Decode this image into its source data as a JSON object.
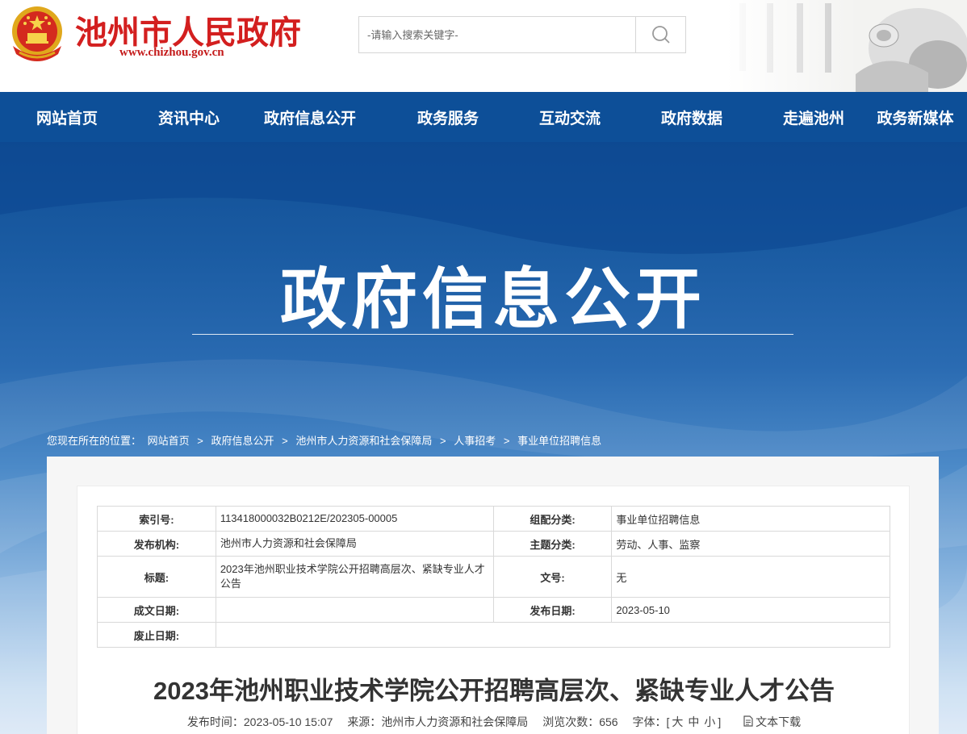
{
  "header": {
    "site_name": "池州市人民政府",
    "site_url": "www.chizhou.gov.cn",
    "search_placeholder": "-请输入搜索关键字-",
    "emblem_icon": "national-emblem-icon",
    "search_icon": "search-icon"
  },
  "nav": {
    "items": [
      {
        "label": "网站首页"
      },
      {
        "label": "资讯中心"
      },
      {
        "label": "政府信息公开"
      },
      {
        "label": "政务服务"
      },
      {
        "label": "互动交流"
      },
      {
        "label": "政府数据"
      },
      {
        "label": "走遍池州"
      },
      {
        "label": "政务新媒体"
      }
    ]
  },
  "banner": {
    "title": "政府信息公开"
  },
  "breadcrumb": {
    "prefix": "您现在所在的位置：",
    "items": [
      "网站首页",
      "政府信息公开",
      "池州市人力资源和社会保障局",
      "人事招考",
      "事业单位招聘信息"
    ],
    "separator": ">"
  },
  "meta": {
    "index_label": "索引号:",
    "index_value": "113418000032B0212E/202305-00005",
    "category_label": "组配分类:",
    "category_value": "事业单位招聘信息",
    "publisher_label": "发布机构:",
    "publisher_value": "池州市人力资源和社会保障局",
    "topic_label": "主题分类:",
    "topic_value": "劳动、人事、监察",
    "title_label": "标题:",
    "title_value": "2023年池州职业技术学院公开招聘高层次、紧缺专业人才公告",
    "docno_label": "文号:",
    "docno_value": "无",
    "created_label": "成文日期:",
    "created_value": "",
    "published_label": "发布日期:",
    "published_value": "2023-05-10",
    "expiry_label": "废止日期:",
    "expiry_value": ""
  },
  "article": {
    "title": "2023年池州职业技术学院公开招聘高层次、紧缺专业人才公告",
    "publish_time_label": "发布时间：",
    "publish_time": "2023-05-10 15:07",
    "source_label": "来源：",
    "source": "池州市人力资源和社会保障局",
    "views_label": "浏览次数：",
    "views": "656",
    "font_label": "字体：",
    "font_open": "[",
    "font_large": "大",
    "font_medium": "中",
    "font_small": "小",
    "font_close": "]",
    "download_icon": "document-icon",
    "download_label": "文本下载"
  },
  "colors": {
    "nav_bg": "#0d4f98",
    "site_name": "#d31f1f",
    "text": "#333333"
  }
}
